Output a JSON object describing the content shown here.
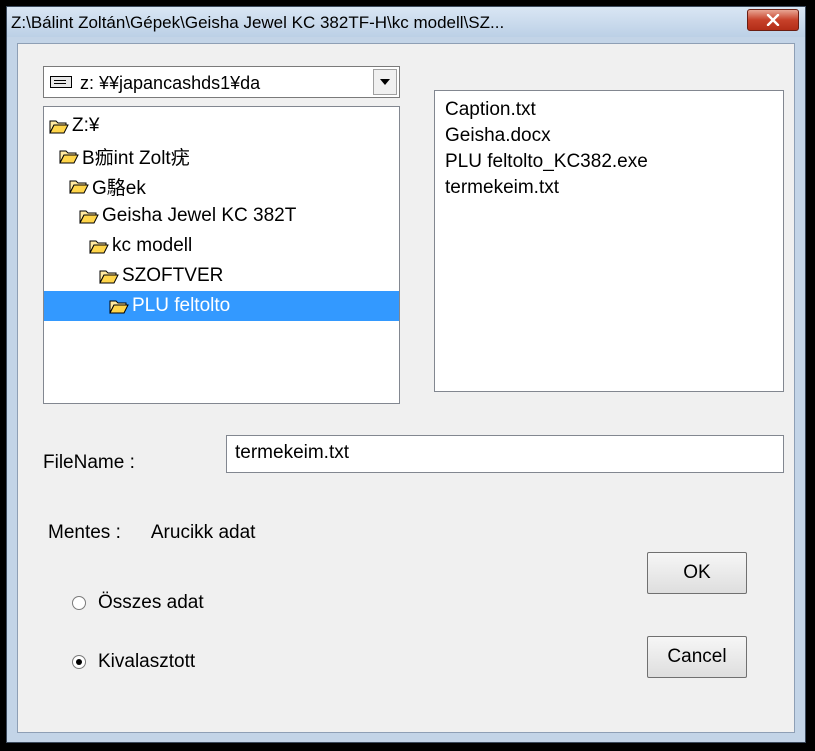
{
  "window": {
    "title": "Z:\\Bálint Zoltán\\Gépek\\Geisha Jewel KC 382TF-H\\kc modell\\SZ...",
    "close_icon": "close-x-icon"
  },
  "drive": {
    "value": "z: ¥¥japancashds1¥da",
    "icon": "drive-icon"
  },
  "tree": {
    "items": [
      {
        "label": "Z:¥"
      },
      {
        "label": "B痂int Zolt疣"
      },
      {
        "label": "G駱ek"
      },
      {
        "label": "Geisha Jewel KC 382T"
      },
      {
        "label": "kc modell"
      },
      {
        "label": "SZOFTVER"
      },
      {
        "label": "PLU feltolto"
      }
    ],
    "selected_index": 6
  },
  "files": [
    {
      "label": "Caption.txt"
    },
    {
      "label": "Geisha.docx"
    },
    {
      "label": "PLU feltolto_KC382.exe"
    },
    {
      "label": "termekeim.txt"
    }
  ],
  "filename": {
    "label": "FileName :",
    "value": "termekeim.txt"
  },
  "mentes": {
    "label": "Mentes :",
    "value": "Arucikk adat"
  },
  "options": [
    {
      "label": "Összes adat",
      "checked": false
    },
    {
      "label": "Kivalasztott",
      "checked": true
    }
  ],
  "buttons": {
    "ok": "OK",
    "cancel": "Cancel"
  },
  "colors": {
    "selection": "#3399ff",
    "close_button": "#c7412a"
  }
}
